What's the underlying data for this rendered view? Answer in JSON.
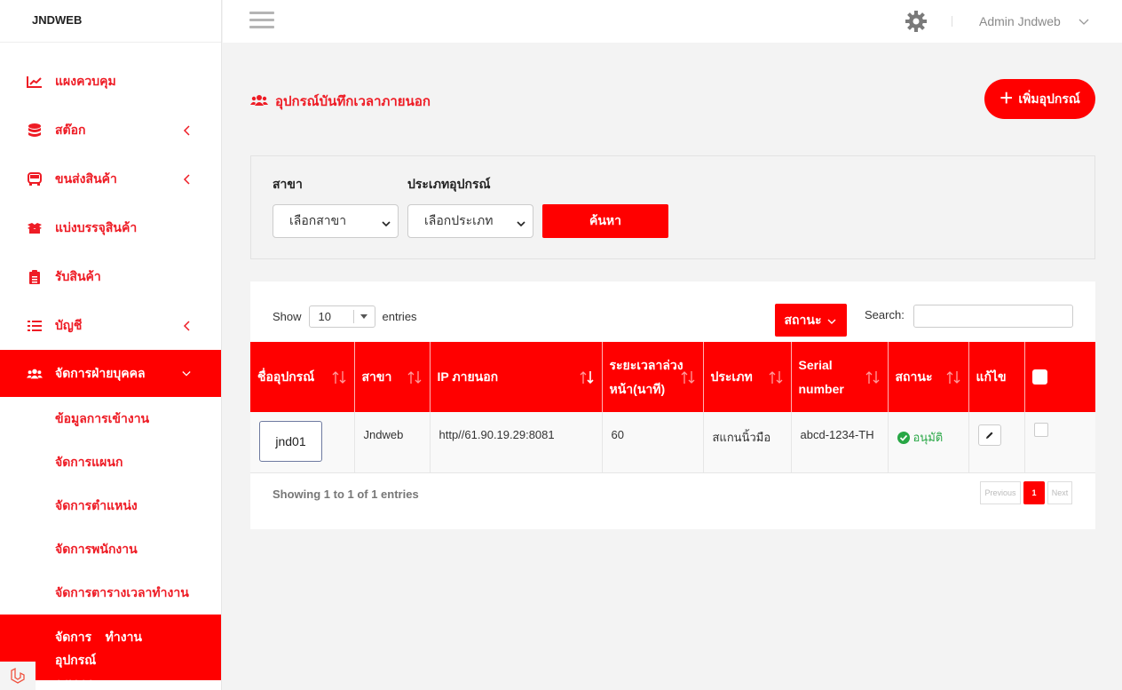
{
  "brand": "JNDWEB",
  "sidebar": {
    "items": [
      {
        "label": "แผงควบคุม",
        "icon": "chart-line-icon"
      },
      {
        "label": "สต๊อก",
        "icon": "database-icon"
      },
      {
        "label": "ขนส่งสินค้า",
        "icon": "bus-icon"
      },
      {
        "label": "แบ่งบรรจุสินค้า",
        "icon": "boxes-icon"
      },
      {
        "label": "รับสินค้า",
        "icon": "clipboard-icon"
      },
      {
        "label": "บัญชี",
        "icon": "list-icon"
      },
      {
        "label": "จัดการฝ่ายบุคคล",
        "icon": "users-icon"
      }
    ],
    "sub_items": [
      {
        "label": "ข้อมูลการเข้างาน"
      },
      {
        "label": "จัดการแผนก"
      },
      {
        "label": "จัดการตำแหน่ง"
      },
      {
        "label": "จัดการพนักงาน"
      },
      {
        "label": "จัดการตารางเวลาทำงาน"
      },
      {
        "label_line1": "จัดการอุปกรณ์ลงเวลา",
        "label_line2": "ทำงาน"
      }
    ]
  },
  "topbar": {
    "user_name": "Admin Jndweb"
  },
  "page": {
    "title": "อุปกรณ์บันทึกเวลาภายนอก",
    "add_button": "เพิ่มอุปกรณ์"
  },
  "filter": {
    "branch_label": "สาขา",
    "branch_value": "เลือกสาขา",
    "type_label": "ประเภทอุปกรณ์",
    "type_value": "เลือกประเภท",
    "search_button": "ค้นหา"
  },
  "table_controls": {
    "show_label": "Show",
    "page_length": "10",
    "entries_label": "entries",
    "status_button": "สถานะ",
    "search_label": "Search:"
  },
  "table": {
    "headers": [
      "ชื่ออุปกรณ์",
      "สาขา",
      "IP ภายนอก",
      "ระยะเวลาล่วงหน้า(นาที)",
      "ประเภท",
      "Serial number",
      "สถานะ",
      "แก้ไข"
    ],
    "rows": [
      {
        "device": "jnd01",
        "branch": "Jndweb",
        "ip": "http//61.90.19.29:8081",
        "lead_time": "60",
        "type": "สแกนนิ้วมือ",
        "serial": "abcd-1234-TH",
        "status": "อนุมัติ"
      }
    ]
  },
  "footer": {
    "showing": "Showing 1 to 1 of 1 entries",
    "prev": "Previous",
    "current_page": "1",
    "next": "Next"
  },
  "colors": {
    "accent": "#ff0000",
    "text_red": "#ee1c25",
    "approved": "#28a745"
  }
}
